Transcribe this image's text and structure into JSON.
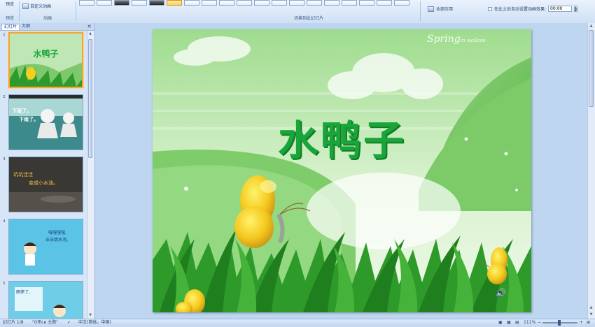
{
  "ribbon": {
    "preview_label": "预览",
    "preview_group": "预览",
    "custom_animation_label": "自定义动画",
    "animation_group": "动画",
    "transition_group": "切换到此幻灯片",
    "apply_all_label": "全部应用",
    "auto_advance_label": "在此之后自动设置动画效果:",
    "auto_advance_time": "00:00"
  },
  "panel": {
    "tab_slides": "幻灯片",
    "tab_outline": "大纲",
    "close": "×",
    "slides": [
      {
        "num": "1",
        "text1": "水鸭子",
        "text2": ""
      },
      {
        "num": "2",
        "text1": "下雨了。",
        "text2": "下雨了。"
      },
      {
        "num": "3",
        "text1": "坑坑洼洼",
        "text2": "变成小水池。"
      },
      {
        "num": "4",
        "text1": "嘎嘎嘎嘎,",
        "text2": "亲亲跳水池。"
      },
      {
        "num": "5",
        "text1": "雨停了,",
        "text2": ""
      }
    ]
  },
  "slide": {
    "title": "水鸭子",
    "logo": "Spring",
    "logo_small": "in wallcoo"
  },
  "status": {
    "slide_info": "幻灯片 1/8",
    "theme": "\"Office 主题\"",
    "language": "中文(简体，中国)",
    "zoom": "111%"
  },
  "colors": {
    "title_green": "#1aa53a",
    "ribbon_bg": "#cfe0f5",
    "selection": "#f4a43a"
  }
}
